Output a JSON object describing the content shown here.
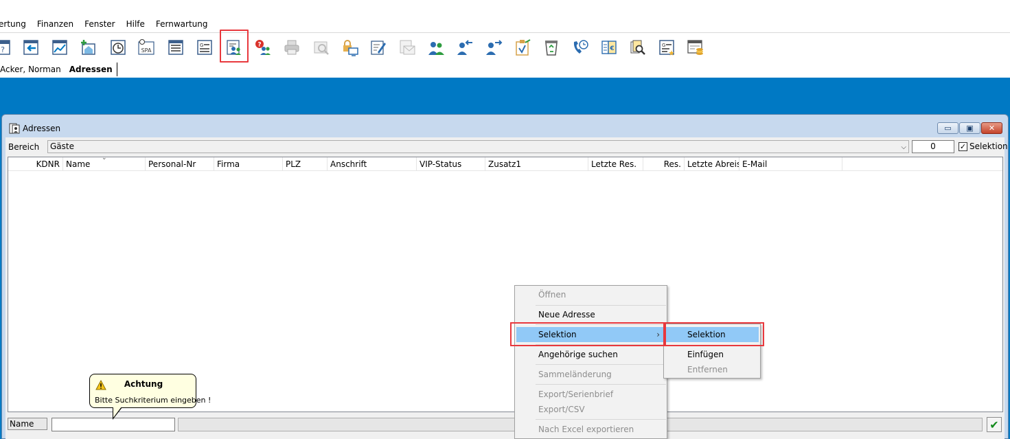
{
  "menu": [
    "ertung",
    "Finanzen",
    "Fenster",
    "Hilfe",
    "Fernwartung"
  ],
  "toolbar_icons": [
    "help-calendar-icon",
    "import-arrow-icon",
    "chart-line-icon",
    "add-house-icon",
    "clock-icon",
    "spa-icon",
    "list-document-icon",
    "invoice-document-icon",
    "addresses-people-icon",
    "address-help-icon",
    "printer-icon",
    "print-preview-icon",
    "lock-screen-icon",
    "edit-notes-icon",
    "envelope-doc-icon",
    "guests-group-icon",
    "arrival-person-icon",
    "departure-person-icon",
    "clipboard-check-icon",
    "recycle-bin-icon",
    "phone-clock-icon",
    "cashbook-icon",
    "file-search-icon",
    "invoice-star-icon",
    "calculator-coins-icon"
  ],
  "tabs": [
    "Acker, Norman",
    "Adressen"
  ],
  "window": {
    "title": "Adressen",
    "filter_label": "Bereich",
    "filter_value": "Gäste",
    "count": "0",
    "selektion_label": "Selektion"
  },
  "columns": [
    "KDNR",
    "Name",
    "Personal-Nr",
    "Firma",
    "PLZ",
    "Anschrift",
    "VIP-Status",
    "Zusatz1",
    "Letzte Res.",
    "Res.",
    "Letzte Abreise",
    "E-Mail"
  ],
  "bottom": {
    "name_label": "Name",
    "name_value": ""
  },
  "tooltip": {
    "title": "Achtung",
    "message": "Bitte Suchkriterium eingeben !"
  },
  "context_menu": {
    "items": [
      "Öffnen",
      "Neue Adresse",
      "Selektion",
      "Angehörige suchen",
      "Sammeländerung",
      "Export/Serienbrief",
      "Export/CSV",
      "Nach Excel exportieren"
    ]
  },
  "submenu": {
    "items": [
      "Selektion",
      "Einfügen",
      "Entfernen"
    ]
  },
  "colors": {
    "accent_blue": "#0079c4",
    "highlight": "#91c9f7",
    "annotation_red": "#e8383d"
  }
}
